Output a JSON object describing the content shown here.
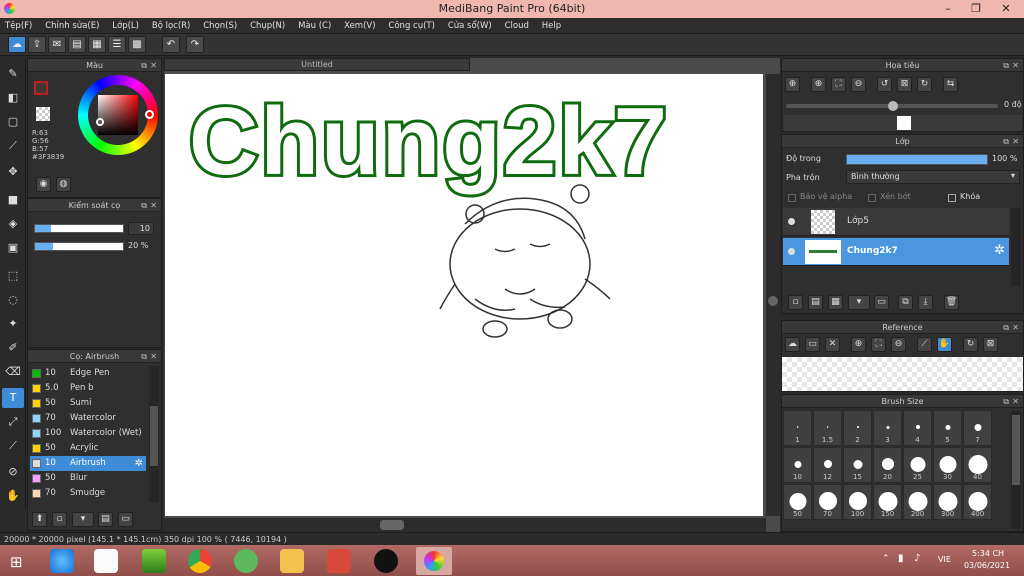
{
  "window": {
    "title": "MediBang Paint Pro (64bit)"
  },
  "menu": [
    "Tệp(F)",
    "Chỉnh sửa(E)",
    "Lớp(L)",
    "Bộ lọc(R)",
    "Chọn(S)",
    "Chụp(N)",
    "Màu (C)",
    "Xem(V)",
    "Công cụ(T)",
    "Cửa sổ(W)",
    "Cloud",
    "Help"
  ],
  "color_panel": {
    "title": "Màu",
    "r": "R:63",
    "g": "G:56",
    "b": "B:57",
    "hex": "#3F3839"
  },
  "control_panel": {
    "title": "Kiểm soát cọ",
    "size_value": "10",
    "opacity_value": "20 %",
    "opacity_fraction": 0.2
  },
  "brush_panel": {
    "title": "Cọ: Airbrush",
    "brushes": [
      {
        "size": "10",
        "name": "Edge Pen",
        "color": "#00c000"
      },
      {
        "size": "5.0",
        "name": "Pen b",
        "color": "#ffd400"
      },
      {
        "size": "50",
        "name": "Sumi",
        "color": "#ffd400"
      },
      {
        "size": "70",
        "name": "Watercolor",
        "color": "#8fd4ff"
      },
      {
        "size": "100",
        "name": "Watercolor (Wet)",
        "color": "#8fd4ff"
      },
      {
        "size": "50",
        "name": "Acrylic",
        "color": "#ffd400"
      },
      {
        "size": "10",
        "name": "Airbrush",
        "color": "#dddddd"
      },
      {
        "size": "50",
        "name": "Blur",
        "color": "#f8a0f8"
      },
      {
        "size": "70",
        "name": "Smudge",
        "color": "#ffd9b3"
      }
    ]
  },
  "canvas": {
    "tab_title": "Untitled",
    "artwork_text": "Chung2k7"
  },
  "navigator": {
    "title": "Họa tiêu",
    "angle": "0 độ"
  },
  "layer_panel": {
    "title": "Lớp",
    "opacity_label": "Độ trong",
    "opacity_value": "100 %",
    "blend_label": "Pha trộn",
    "blend_value": "Bình thường",
    "protect_alpha": "Bảo vệ alpha",
    "clipping": "Xén bớt",
    "lock": "Khóa",
    "layers": [
      {
        "name": "Lớp5"
      },
      {
        "name": "Chung2k7"
      }
    ]
  },
  "reference_panel": {
    "title": "Reference"
  },
  "brush_size_panel": {
    "title": "Brush Size",
    "sizes": [
      "1",
      "1.5",
      "2",
      "3",
      "4",
      "5",
      "7",
      "10",
      "12",
      "15",
      "20",
      "25",
      "30",
      "40",
      "50",
      "70",
      "100",
      "150",
      "200",
      "300",
      "400"
    ]
  },
  "status": {
    "text": "20000 * 20000 pixel   (145.1 * 145.1cm)   350 dpi   100 %   ( 7446, 10194 )"
  },
  "taskbar": {
    "language": "VIE",
    "time": "5:34 CH",
    "date": "03/06/2021"
  }
}
